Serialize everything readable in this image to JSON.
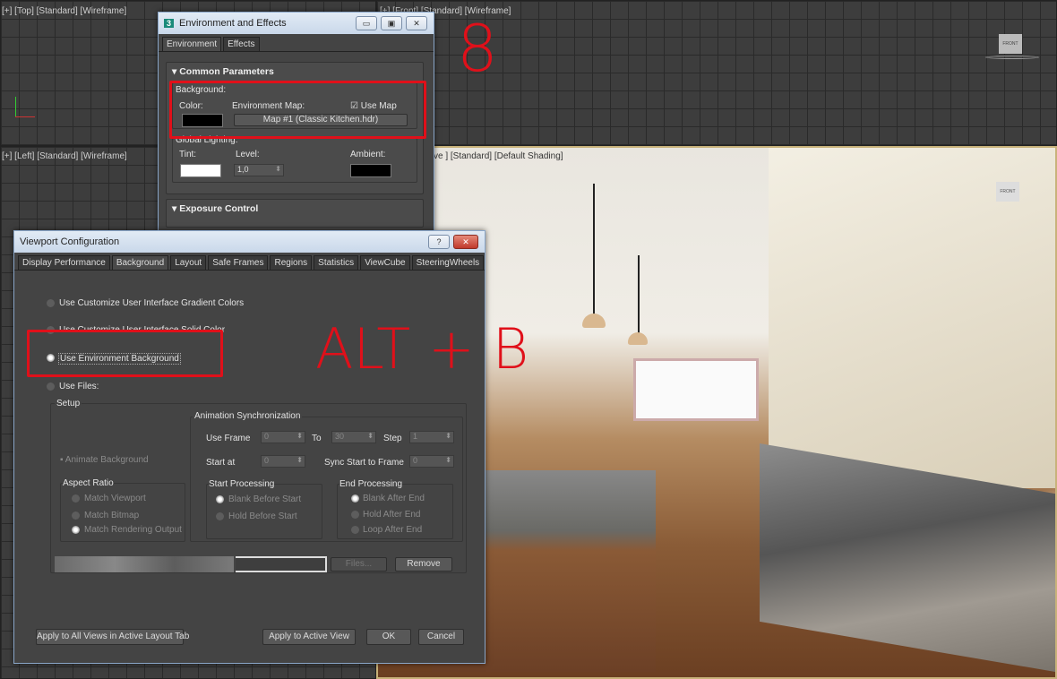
{
  "viewports": {
    "top": "[+] [Top] [Standard] [Wireframe]",
    "front": "[+] [Front] [Standard] [Wireframe]",
    "left": "[+] [Left] [Standard] [Wireframe]",
    "perspective": "ve ] [Standard] [Default Shading]",
    "viewcube_front": "FRONT",
    "viewcube_front2": "FRONT"
  },
  "env_dialog": {
    "title": "Environment and Effects",
    "app_icon": "3",
    "tabs": [
      "Environment",
      "Effects"
    ],
    "common_parameters": "Common Parameters",
    "background_label": "Background:",
    "color_label": "Color:",
    "env_map_label": "Environment Map:",
    "use_map_label": "Use Map",
    "use_map_checked": true,
    "map_button": "Map #1 (Classic Kitchen.hdr)",
    "global_lighting": "Global Lighting:",
    "tint_label": "Tint:",
    "level_label": "Level:",
    "level_value": "1,0",
    "ambient_label": "Ambient:",
    "exposure_control": "Exposure Control",
    "colors": {
      "bg_color": "#000000",
      "tint": "#ffffff",
      "ambient": "#000000"
    }
  },
  "vp_dialog": {
    "title": "Viewport Configuration",
    "help": "?",
    "close": "✕",
    "tabs": [
      "Display Performance",
      "Background",
      "Layout",
      "Safe Frames",
      "Regions",
      "Statistics",
      "ViewCube",
      "SteeringWheels"
    ],
    "options": [
      "Use Customize User Interface Gradient Colors",
      "Use Customize User Interface Solid Color",
      "Use Environment Background",
      "Use Files:"
    ],
    "selected_option": "Use Environment Background",
    "setup": "Setup",
    "animate_background": "Animate Background",
    "anim_sync": "Animation Synchronization",
    "use_frame": "Use Frame",
    "use_frame_val": "0",
    "to": "To",
    "to_val": "30",
    "step": "Step",
    "step_val": "1",
    "start_at": "Start at",
    "start_at_val": "0",
    "sync_start": "Sync Start to Frame",
    "sync_start_val": "0",
    "aspect_ratio": "Aspect Ratio",
    "aspect_options": [
      "Match Viewport",
      "Match Bitmap",
      "Match Rendering Output"
    ],
    "start_processing": "Start Processing",
    "start_options": [
      "Blank Before Start",
      "Hold Before Start"
    ],
    "end_processing": "End Processing",
    "end_options": [
      "Blank After End",
      "Hold After End",
      "Loop After End"
    ],
    "files_btn": "Files...",
    "remove_btn": "Remove",
    "apply_all": "Apply to All Views in Active Layout Tab",
    "apply_active": "Apply to Active View",
    "ok": "OK",
    "cancel": "Cancel"
  },
  "annotations": {
    "eight": "8",
    "shortcut": "ALT + B"
  }
}
